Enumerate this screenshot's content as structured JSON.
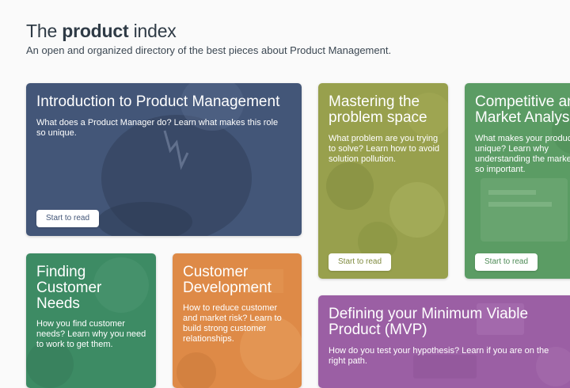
{
  "header": {
    "title_prefix": "The ",
    "title_bold": "product",
    "title_suffix": " index",
    "subtitle": "An open and organized directory of the best pieces about Product Management."
  },
  "colors": {
    "intro": "#425577",
    "problem": "#97a24c",
    "competitive": "#5a9a63",
    "finding": "#3c8a63",
    "customer_dev": "#dd8a46",
    "mvp": "#9a5fa3"
  },
  "cards": {
    "intro": {
      "title": "Introduction to Product Management",
      "desc": "What does a Product Manager do? Learn what makes this role so unique.",
      "cta": "Start to read"
    },
    "problem": {
      "title": "Mastering the problem space",
      "desc": "What problem are you trying to solve? Learn how to avoid solution pollution.",
      "cta": "Start to read"
    },
    "competitive": {
      "title": "Competitive and Market Analysis",
      "desc": "What makes your product unique? Learn why understanding the market is so important.",
      "cta": "Start to read"
    },
    "finding": {
      "title": "Finding Customer Needs",
      "desc": "How you find customer needs? Learn why you need to work to get them."
    },
    "customer_dev": {
      "title": "Customer Development",
      "desc": "How to reduce customer and market risk? Learn to build strong customer relationships."
    },
    "mvp": {
      "title": "Defining your Minimum Viable Product (MVP)",
      "desc": "How do you test your hypothesis? Learn if you are on the right path."
    }
  }
}
